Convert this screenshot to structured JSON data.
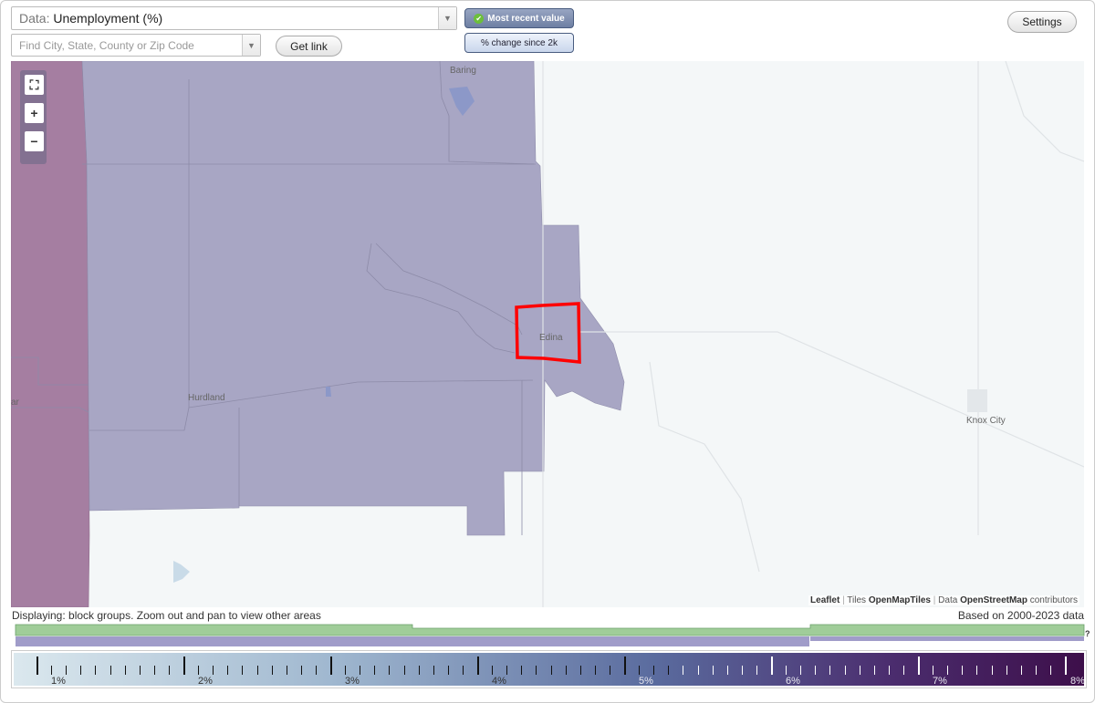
{
  "controls": {
    "data_label": "Data:",
    "data_value": "Unemployment (%)",
    "search_placeholder": "Find City, State, County or Zip Code",
    "get_link": "Get link",
    "toggle_recent": "Most recent value",
    "toggle_change": "% change since 2k",
    "settings": "Settings"
  },
  "map": {
    "places": [
      "Baring",
      "Edina",
      "Hurdland",
      "Knox City",
      "ar"
    ],
    "attribution": {
      "leaflet": "Leaflet",
      "sep": "|",
      "tiles_prefix": "Tiles",
      "tiles": "OpenMapTiles",
      "data_prefix": "Data",
      "osm": "OpenStreetMap",
      "contributors": "contributors"
    },
    "highlight_color": "#ff0000",
    "region_colors": {
      "low": "#a8a6c4",
      "high": "#a57ea1",
      "none": "#f4f7f8"
    }
  },
  "status": {
    "displaying": "Displaying: block groups. Zoom out and pan to view other areas",
    "based_on": "Based on 2000-2023 data",
    "hist_help": "?"
  },
  "legend": {
    "labels": [
      "1%",
      "2%",
      "3%",
      "4%",
      "5%",
      "6%",
      "7%",
      "8%"
    ],
    "min": 1,
    "max": 8
  }
}
